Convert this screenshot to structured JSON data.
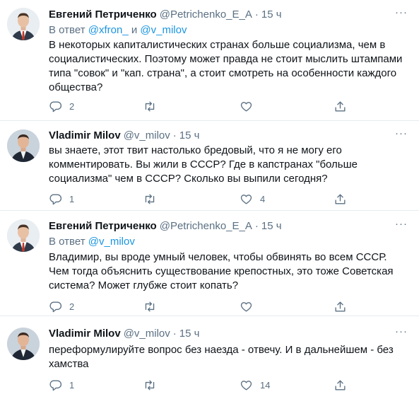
{
  "tweets": [
    {
      "name": "Евгений Петриченко",
      "handle": "@Petrichenko_E_A",
      "dot": "·",
      "time": "15 ч",
      "reply_prefix": "В ответ",
      "reply_mentions": [
        "@xfron_",
        "@v_milov"
      ],
      "reply_joiner": "и",
      "text": "В некоторых капиталистических странах больше социализма, чем в социалистических. Поэтому может правда не стоит мыслить штампами типа \"совок\" и \"кап. страна\", а стоит смотреть на особенности каждого общества?",
      "replies": "2",
      "retweets": "",
      "likes": "",
      "avatar": "man-in-suit-red-tie"
    },
    {
      "name": "Vladimir Milov",
      "handle": "@v_milov",
      "dot": "·",
      "time": "15 ч",
      "text": "вы знаете, этот твит настолько бредовый, что я не могу его комментировать. Вы жили в СССР? Где в капстранах \"больше социализма\" чем в СССР? Сколько вы выпили сегодня?",
      "replies": "1",
      "retweets": "",
      "likes": "4",
      "avatar": "man-in-dark-suit"
    },
    {
      "name": "Евгений Петриченко",
      "handle": "@Petrichenko_E_A",
      "dot": "·",
      "time": "15 ч",
      "reply_prefix": "В ответ",
      "reply_mentions": [
        "@v_milov"
      ],
      "text": "Владимир, вы вроде умный человек, чтобы обвинять во всем СССР. Чем тогда объяснить существование крепостных, это тоже Советская система? Может глубже стоит копать?",
      "replies": "2",
      "retweets": "",
      "likes": "",
      "avatar": "man-in-suit-red-tie"
    },
    {
      "name": "Vladimir Milov",
      "handle": "@v_milov",
      "dot": "·",
      "time": "15 ч",
      "text": "переформулируйте вопрос без наезда - отвечу. И в дальнейшем - без хамства",
      "replies": "1",
      "retweets": "",
      "likes": "14",
      "avatar": "man-in-dark-suit"
    }
  ],
  "icons": {
    "more": "more-dots-icon",
    "reply": "reply-bubble-icon",
    "retweet": "retweet-arrows-icon",
    "like": "heart-icon",
    "share": "share-upload-icon"
  },
  "more_glyph": "···",
  "colors": {
    "text": "#0f1419",
    "secondary": "#5b7083",
    "link": "#1b95e0",
    "divider": "#e6ecf0"
  }
}
